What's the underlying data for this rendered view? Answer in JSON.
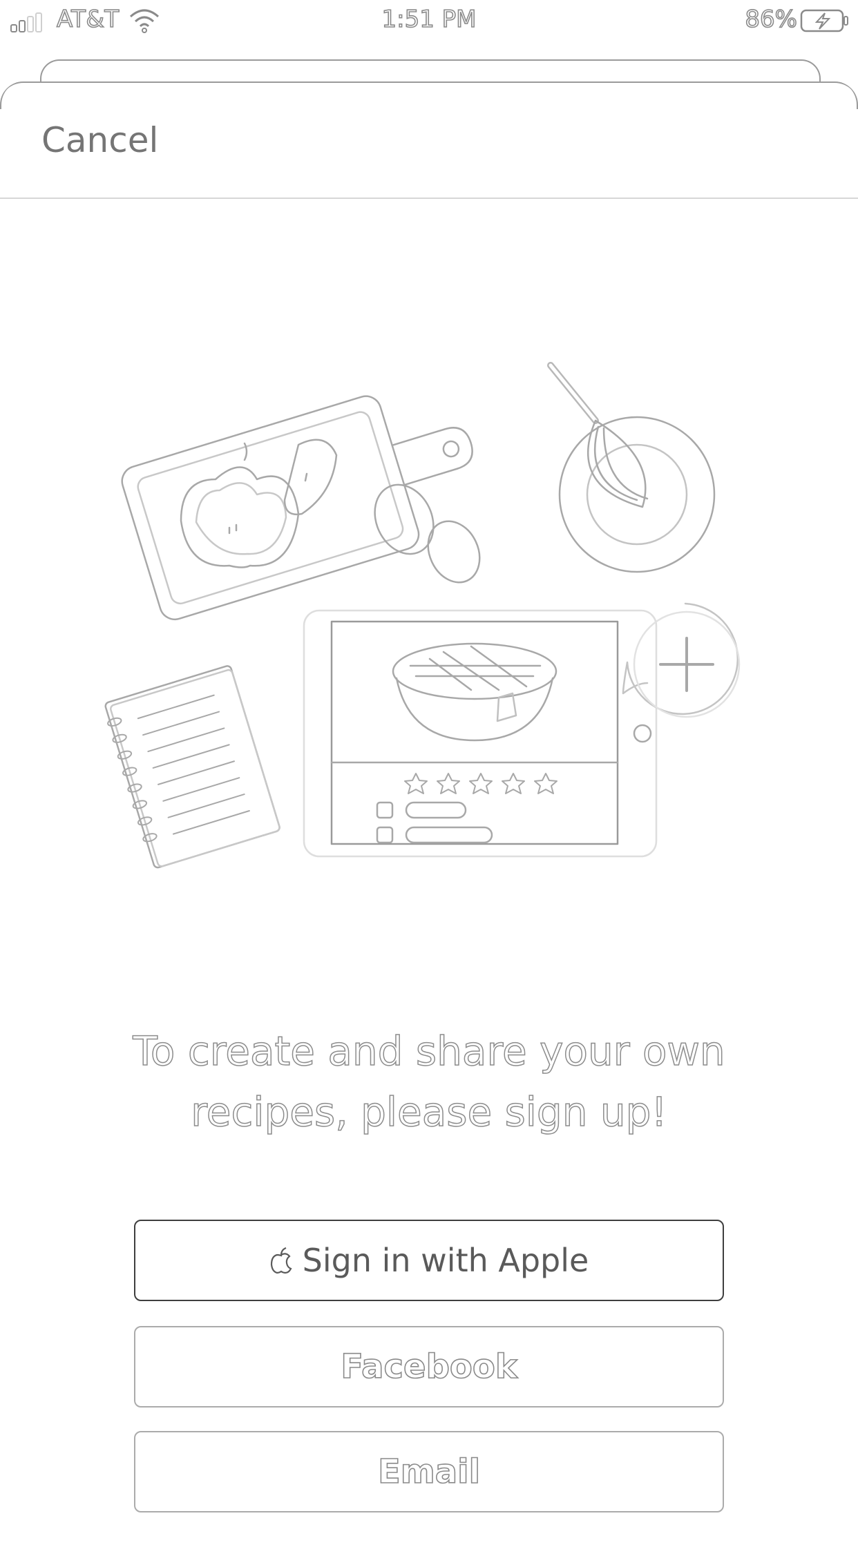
{
  "status_bar": {
    "carrier": "AT&T",
    "time": "1:51 PM",
    "battery_percent": "86%",
    "icons": [
      "signal-icon",
      "wifi-icon",
      "battery-charging-icon"
    ]
  },
  "nav": {
    "cancel_label": "Cancel"
  },
  "illustration": {
    "icon": "recipe-illustration",
    "rating_stars": 5
  },
  "main": {
    "headline": "To create and share your own recipes, please sign up!"
  },
  "buttons": {
    "apple_label": "Sign in with Apple",
    "apple_icon": "apple-icon",
    "facebook_label": "Facebook",
    "email_label": "Email"
  },
  "colors": {
    "primary_border": "#3e3e3e",
    "secondary_border": "#ababab",
    "background": "#ffffff"
  }
}
